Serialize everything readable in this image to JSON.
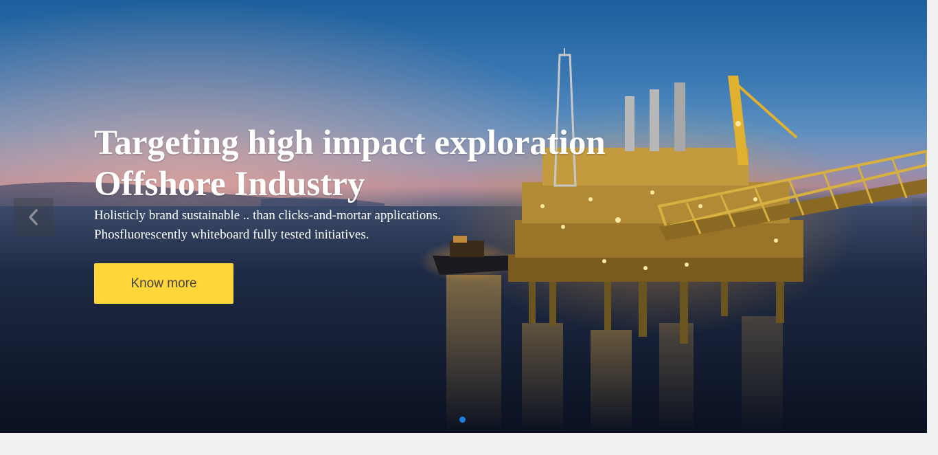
{
  "hero": {
    "title_line1": "Targeting high impact exploration",
    "title_line2": "Offshore Industry",
    "subtitle_line1": "Holisticly brand sustainable .. than clicks-and-mortar applications.",
    "subtitle_line2": "Phosfluorescently whiteboard fully tested initiatives.",
    "cta_label": "Know more"
  },
  "carousel": {
    "prev_icon": "chevron-left-icon",
    "next_icon": "chevron-right-icon",
    "active_indicator_color": "#1a7fe0",
    "slide_count": 1,
    "active_slide": 1
  },
  "colors": {
    "cta_background": "#ffd63a",
    "cta_text": "#444444",
    "page_background": "#f1f1f1"
  }
}
